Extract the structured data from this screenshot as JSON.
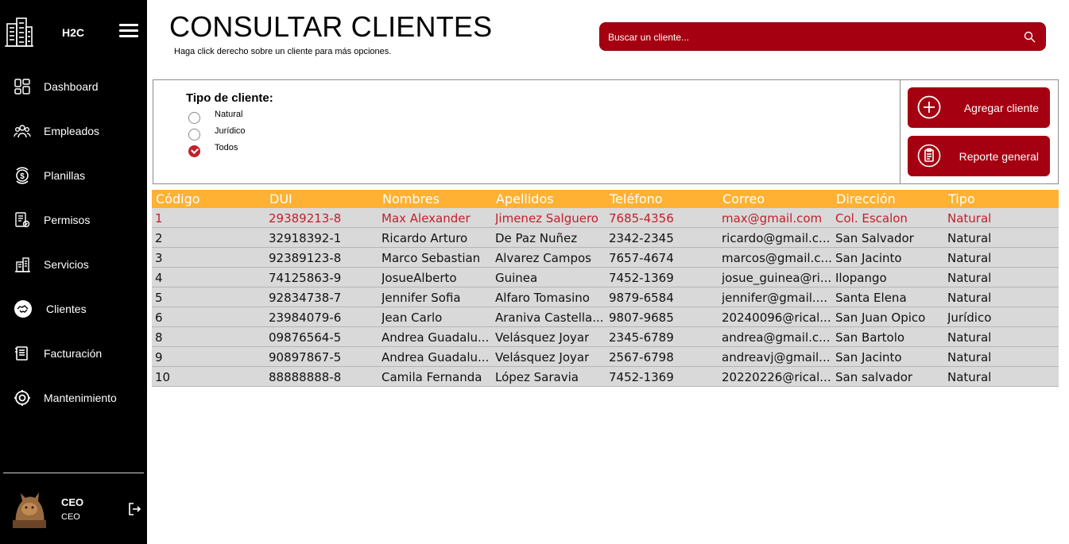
{
  "sidebar": {
    "brand": "H2C",
    "items": [
      {
        "label": "Dashboard",
        "icon": "dashboard-icon"
      },
      {
        "label": "Empleados",
        "icon": "employees-icon"
      },
      {
        "label": "Planillas",
        "icon": "payroll-icon"
      },
      {
        "label": "Permisos",
        "icon": "permissions-icon"
      },
      {
        "label": "Servicios",
        "icon": "services-icon"
      },
      {
        "label": "Clientes",
        "icon": "handshake-icon"
      },
      {
        "label": "Facturación",
        "icon": "invoice-icon"
      },
      {
        "label": "Mantenimiento",
        "icon": "maintenance-icon"
      }
    ],
    "user": {
      "name": "CEO",
      "role": "CEO"
    }
  },
  "header": {
    "title": "CONSULTAR CLIENTES",
    "subtitle": "Haga click derecho sobre un cliente para más opciones."
  },
  "search": {
    "placeholder": "Buscar un cliente..."
  },
  "filter": {
    "title": "Tipo de cliente:",
    "options": [
      "Natural",
      "Jurídico",
      "Todos"
    ],
    "selected": "Todos"
  },
  "actions": {
    "add": "Agregar cliente",
    "report": "Reporte general"
  },
  "colors": {
    "sidebar": "#000000",
    "accent": "#a50011",
    "table_header": "#ffb133",
    "row_bg": "#d9d9d9",
    "selected_text": "#c1202b"
  },
  "table": {
    "columns": [
      "Código",
      "DUI",
      "Nombres",
      "Apellidos",
      "Teléfono",
      "Correo",
      "Dirección",
      "Tipo"
    ],
    "selected_row": 0,
    "rows": [
      [
        "1",
        "29389213-8",
        "Max Alexander",
        "Jimenez Salguero",
        "7685-4356",
        "max@gmail.com",
        "Col. Escalon",
        "Natural"
      ],
      [
        "2",
        "32918392-1",
        "Ricardo Arturo",
        "De Paz Nuñez",
        "2342-2345",
        "ricardo@gmail.c...",
        "San Salvador",
        "Natural"
      ],
      [
        "3",
        "92389123-8",
        "Marco Sebastian",
        "Alvarez Campos",
        "7657-4674",
        "marcos@gmail.c...",
        "San Jacinto",
        "Natural"
      ],
      [
        "4",
        "74125863-9",
        "JosueAlberto",
        "Guinea",
        "7452-1369",
        "josue_guinea@ri...",
        "Ilopango",
        "Natural"
      ],
      [
        "5",
        "92834738-7",
        "Jennifer Sofia",
        "Alfaro Tomasino",
        "9879-6584",
        "jennifer@gmail....",
        "Santa Elena",
        "Natural"
      ],
      [
        "6",
        "23984079-6",
        "Jean Carlo",
        "Araniva Castella...",
        "9807-9685",
        "20240096@rical...",
        "San Juan Opico",
        "Jurídico"
      ],
      [
        "8",
        "09876564-5",
        "Andrea Guadalu...",
        "Velásquez Joyar",
        "2345-6789",
        "andrea@gmail.c...",
        "San Bartolo",
        "Natural"
      ],
      [
        "9",
        "90897867-5",
        "Andrea Guadalu...",
        "Velásquez Joyar",
        "2567-6798",
        "andreavj@gmail....",
        "San Jacinto",
        "Natural"
      ],
      [
        "10",
        "88888888-8",
        "Camila Fernanda",
        "López Saravia",
        "7452-1369",
        "20220226@rical...",
        "San salvador",
        "Natural"
      ]
    ]
  }
}
